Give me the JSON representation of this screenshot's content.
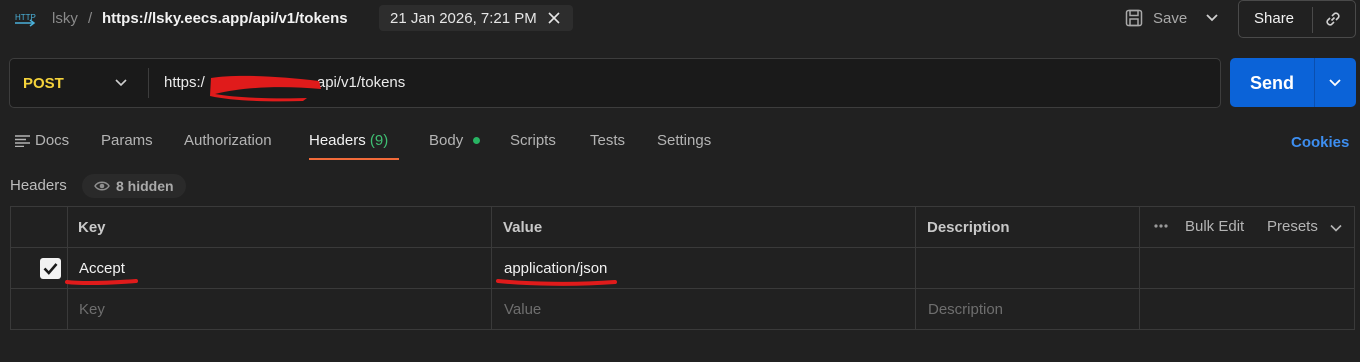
{
  "header": {
    "protocol_badge": "HTTP",
    "breadcrumb_parent": "lsky",
    "breadcrumb_sep": "/",
    "request_title": "https://lsky.eecs.app/api/v1/tokens",
    "history_tab": "21 Jan 2026, 7:21 PM",
    "save_label": "Save",
    "share_label": "Share"
  },
  "request": {
    "method": "POST",
    "url_prefix": "https:/",
    "url_suffix": "api/v1/tokens",
    "send_label": "Send"
  },
  "tabs": [
    {
      "label": "Docs"
    },
    {
      "label": "Params"
    },
    {
      "label": "Authorization"
    },
    {
      "label": "Headers",
      "count": "(9)",
      "active": true
    },
    {
      "label": "Body"
    },
    {
      "label": "Scripts"
    },
    {
      "label": "Tests"
    },
    {
      "label": "Settings"
    }
  ],
  "cookies_label": "Cookies",
  "headers_section": {
    "title": "Headers",
    "hidden_label": "8 hidden"
  },
  "table": {
    "columns": {
      "key": "Key",
      "value": "Value",
      "description": "Description"
    },
    "bulk_edit": "Bulk Edit",
    "presets": "Presets",
    "rows": [
      {
        "checked": true,
        "key": "Accept",
        "value": "application/json",
        "description": ""
      }
    ],
    "placeholders": {
      "key": "Key",
      "value": "Value",
      "description": "Description"
    }
  },
  "colors": {
    "method": "#f5d33b",
    "send": "#0b63d8",
    "active_tab_underline": "#f26b3a",
    "headers_count": "#3fbf73",
    "cookies": "#3d8ef0",
    "annotation": "#e01b1b"
  },
  "icons": [
    "http-icon",
    "close-icon",
    "save-icon",
    "chevron-down-icon",
    "link-icon",
    "docs-icon",
    "eye-icon",
    "more-icon",
    "checkmark-icon"
  ]
}
